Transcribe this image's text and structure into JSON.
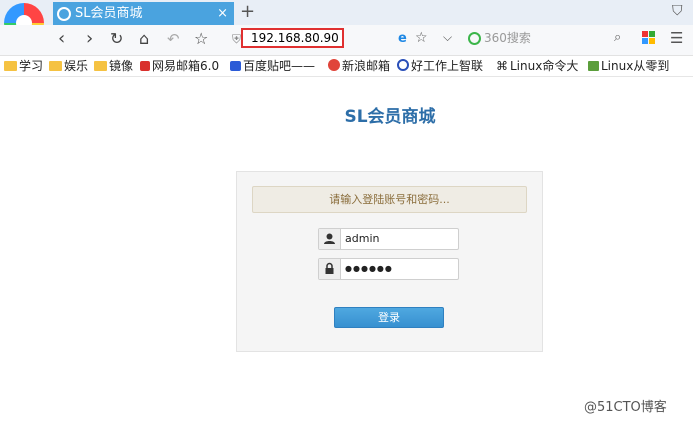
{
  "browser": {
    "tab_title": "SL会员商城",
    "tab_close": "×",
    "new_tab": "+",
    "address": "192.168.80.90",
    "search_placeholder": "360搜索",
    "nav": {
      "back": "‹",
      "forward": "›",
      "reload": "↻",
      "home": "⌂",
      "undo": "↶",
      "favorite": "☆"
    }
  },
  "bookmarks": [
    {
      "label": "学习",
      "icon": "folder"
    },
    {
      "label": "娱乐",
      "icon": "folder"
    },
    {
      "label": "镜像",
      "icon": "folder"
    },
    {
      "label": "网易邮箱6.0",
      "icon": "red"
    },
    {
      "label": "百度贴吧——",
      "icon": "blue"
    },
    {
      "label": "新浪邮箱",
      "icon": "wb"
    },
    {
      "label": "好工作上智联",
      "icon": "globe"
    },
    {
      "label": "Linux命令大",
      "icon": "cmd"
    },
    {
      "label": "Linux从零到",
      "icon": "green"
    }
  ],
  "page": {
    "title": "SL会员商城",
    "prompt": "请输入登陆账号和密码...",
    "username_value": "admin",
    "password_value": "●●●●●●",
    "login_label": "登录"
  },
  "watermark": "@51CTO博客",
  "colors": {
    "accent": "#4aa3df",
    "title": "#2d6ea8",
    "highlight": "#e03030"
  }
}
